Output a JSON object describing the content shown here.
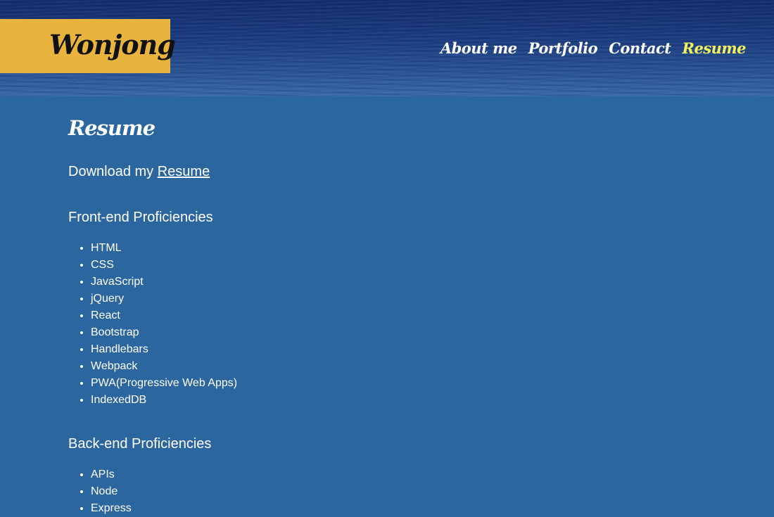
{
  "header": {
    "logo": "Wonjong",
    "nav": [
      {
        "label": "About me"
      },
      {
        "label": "Portfolio"
      },
      {
        "label": "Contact"
      },
      {
        "label": "Resume"
      }
    ],
    "active_nav": "Resume"
  },
  "colors": {
    "logo_bg": "#e8b43e",
    "page_bg": "#2c669e",
    "active_nav": "#f4f25b"
  },
  "main": {
    "title": "Resume",
    "download_prefix": "Download my ",
    "download_link": "Resume",
    "frontend": {
      "title": "Front-end Proficiencies",
      "items": [
        "HTML",
        "CSS",
        "JavaScript",
        "jQuery",
        "React",
        "Bootstrap",
        "Handlebars",
        "Webpack",
        "PWA(Progressive Web Apps)",
        "IndexedDB"
      ]
    },
    "backend": {
      "title": "Back-end Proficiencies",
      "items": [
        "APIs",
        "Node",
        "Express"
      ]
    }
  }
}
